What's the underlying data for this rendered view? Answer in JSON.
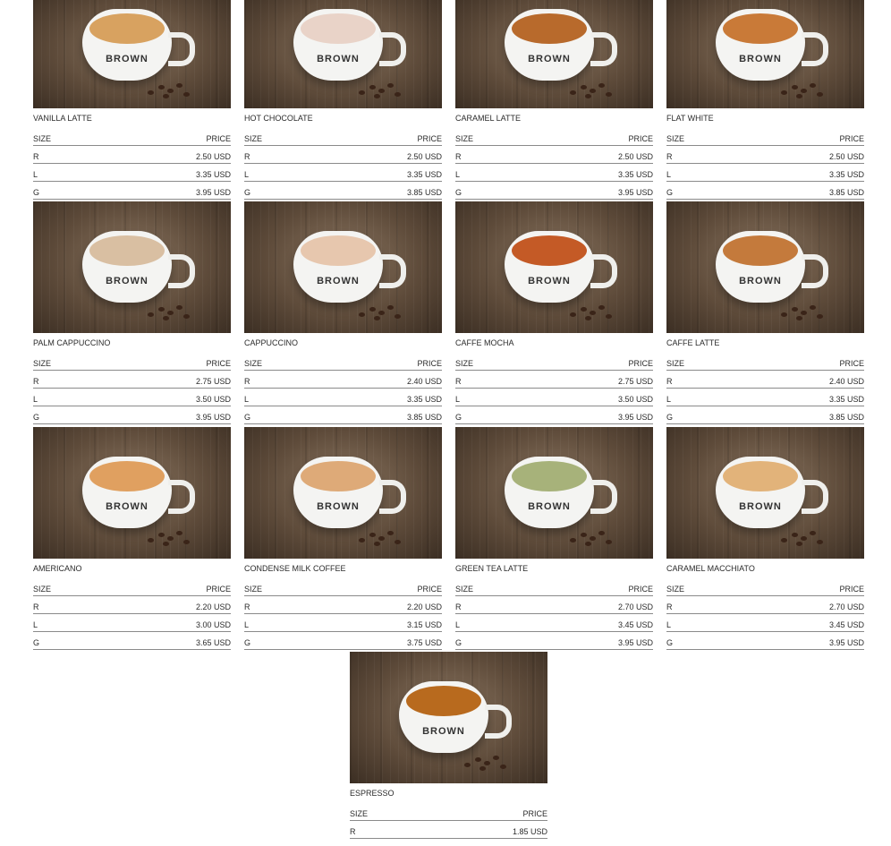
{
  "headers": {
    "size": "SIZE",
    "price": "PRICE"
  },
  "logo_text": "BROWN",
  "items": [
    {
      "name": "VANILLA LATTE",
      "drink_color": "#d8a260",
      "prices": [
        [
          "R",
          "2.50 USD"
        ],
        [
          "L",
          "3.35 USD"
        ],
        [
          "G",
          "3.95 USD"
        ]
      ]
    },
    {
      "name": "HOT CHOCOLATE",
      "drink_color": "#e9d3c8",
      "prices": [
        [
          "R",
          "2.50 USD"
        ],
        [
          "L",
          "3.35 USD"
        ],
        [
          "G",
          "3.85 USD"
        ]
      ]
    },
    {
      "name": "CARAMEL LATTE",
      "drink_color": "#b86a2c",
      "prices": [
        [
          "R",
          "2.50 USD"
        ],
        [
          "L",
          "3.35 USD"
        ],
        [
          "G",
          "3.95 USD"
        ]
      ]
    },
    {
      "name": "FLAT WHITE",
      "drink_color": "#c97a38",
      "prices": [
        [
          "R",
          "2.50 USD"
        ],
        [
          "L",
          "3.35 USD"
        ],
        [
          "G",
          "3.85 USD"
        ]
      ]
    },
    {
      "name": "PALM CAPPUCCINO",
      "drink_color": "#d9bfa2",
      "prices": [
        [
          "R",
          "2.75 USD"
        ],
        [
          "L",
          "3.50 USD"
        ],
        [
          "G",
          "3.95 USD"
        ]
      ]
    },
    {
      "name": "CAPPUCCINO",
      "drink_color": "#e7c7ae",
      "prices": [
        [
          "R",
          "2.40 USD"
        ],
        [
          "L",
          "3.35 USD"
        ],
        [
          "G",
          "3.85 USD"
        ]
      ]
    },
    {
      "name": "CAFFE MOCHA",
      "drink_color": "#c45a26",
      "prices": [
        [
          "R",
          "2.75 USD"
        ],
        [
          "L",
          "3.50 USD"
        ],
        [
          "G",
          "3.95 USD"
        ]
      ]
    },
    {
      "name": "CAFFE LATTE",
      "drink_color": "#c47a3c",
      "prices": [
        [
          "R",
          "2.40 USD"
        ],
        [
          "L",
          "3.35 USD"
        ],
        [
          "G",
          "3.85 USD"
        ]
      ]
    },
    {
      "name": "AMERICANO",
      "drink_color": "#e0a060",
      "prices": [
        [
          "R",
          "2.20 USD"
        ],
        [
          "L",
          "3.00 USD"
        ],
        [
          "G",
          "3.65 USD"
        ]
      ]
    },
    {
      "name": "CONDENSE MILK COFFEE",
      "drink_color": "#deaa78",
      "prices": [
        [
          "R",
          "2.20 USD"
        ],
        [
          "L",
          "3.15 USD"
        ],
        [
          "G",
          "3.75 USD"
        ]
      ]
    },
    {
      "name": "GREEN TEA LATTE",
      "drink_color": "#a7b27a",
      "prices": [
        [
          "R",
          "2.70 USD"
        ],
        [
          "L",
          "3.45 USD"
        ],
        [
          "G",
          "3.95 USD"
        ]
      ]
    },
    {
      "name": "CARAMEL MACCHIATO",
      "drink_color": "#e2b37a",
      "prices": [
        [
          "R",
          "2.70 USD"
        ],
        [
          "L",
          "3.45 USD"
        ],
        [
          "G",
          "3.95 USD"
        ]
      ]
    },
    {
      "name": "ESPRESSO",
      "drink_color": "#b86a1e",
      "prices": [
        [
          "R",
          "1.85 USD"
        ]
      ]
    }
  ]
}
